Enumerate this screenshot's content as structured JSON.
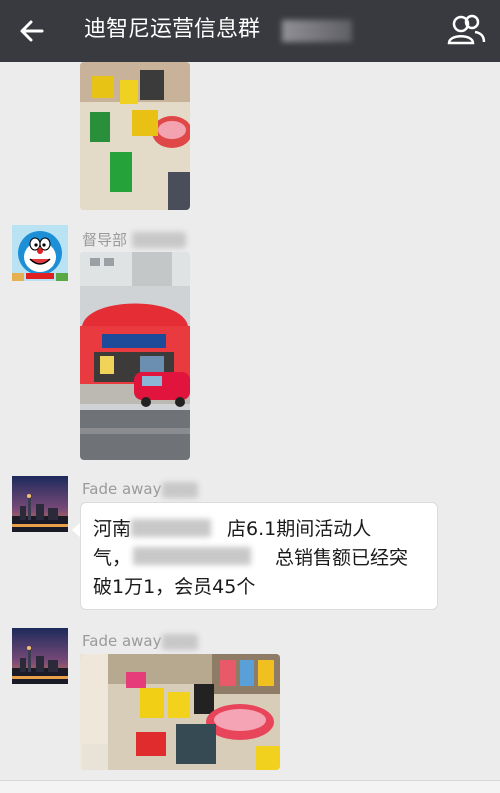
{
  "header": {
    "title": "迪智尼运营信息群",
    "back_icon": "back-arrow-icon",
    "members_icon": "group-members-icon"
  },
  "messages": [
    {
      "type": "image",
      "desc_icon": "photo-children-playroom"
    },
    {
      "sender": "督导部",
      "type": "image",
      "avatar_icon": "doraemon-avatar-icon"
    },
    {
      "sender": "Fade away",
      "type": "text",
      "lines": [
        "河南",
        "店6.1期间活动人",
        "气，",
        "总销售额已经突",
        "破1万1，会员45个"
      ]
    },
    {
      "sender": "Fade away",
      "type": "image"
    }
  ],
  "colors": {
    "header_bg": "#393a3f",
    "chat_bg": "#ececec",
    "bubble_bg": "#ffffff",
    "sender_text": "#9a9a9a"
  }
}
